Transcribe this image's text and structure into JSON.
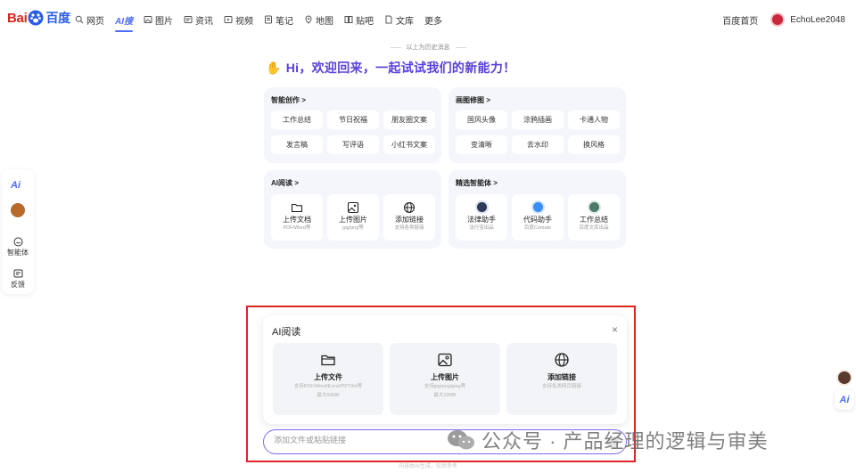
{
  "topbar": {
    "logo": {
      "bai": "Bai",
      "du": "du",
      "cn": "百度"
    },
    "nav": [
      {
        "label": "网页",
        "icon": "search-icon"
      },
      {
        "label": "AI搜",
        "icon": "",
        "active": true
      },
      {
        "label": "图片",
        "icon": "image-icon"
      },
      {
        "label": "资讯",
        "icon": "news-icon"
      },
      {
        "label": "视频",
        "icon": "video-icon"
      },
      {
        "label": "笔记",
        "icon": "note-icon"
      },
      {
        "label": "地图",
        "icon": "map-icon"
      },
      {
        "label": "贴吧",
        "icon": "tieba-icon"
      },
      {
        "label": "文库",
        "icon": "doc-icon"
      },
      {
        "label": "更多",
        "icon": ""
      }
    ],
    "home_link": "百度首页",
    "username": "EchoLee2048"
  },
  "history_divider": "以上为历史消息",
  "welcome": "Hi，欢迎回来，一起试试我们的新能力！",
  "cards": {
    "creation": {
      "title": "智能创作 >",
      "items": [
        "工作总结",
        "节日祝福",
        "朋友圈文案",
        "发言稿",
        "写评语",
        "小红书文案"
      ]
    },
    "image_edit": {
      "title": "画图修图 >",
      "items": [
        "国风头像",
        "涂鸦插画",
        "卡通人物",
        "变清晰",
        "去水印",
        "换风格"
      ]
    },
    "ai_read": {
      "title": "AI阅读 >",
      "items": [
        {
          "label": "上传文档",
          "sub": "PDF/Word等"
        },
        {
          "label": "上传图片",
          "sub": "jpg/png等"
        },
        {
          "label": "添加链接",
          "sub": "支持各类链接"
        }
      ]
    },
    "agents": {
      "title": "精选智能体 >",
      "items": [
        {
          "label": "法律助手",
          "sub": "法行宝出品"
        },
        {
          "label": "代码助手",
          "sub": "百度Comate"
        },
        {
          "label": "工作总结",
          "sub": "百度文库出品"
        }
      ]
    }
  },
  "leftbar": {
    "ai_label": "Ai",
    "items": [
      {
        "label": "智能体"
      },
      {
        "label": "反馈"
      }
    ]
  },
  "right_float": {
    "ai_label": "Ai"
  },
  "panel": {
    "title": "AI阅读",
    "close": "×",
    "tiles": [
      {
        "label": "上传文件",
        "sub1": "支持PDF/Word/Excel/PPT/txt等",
        "sub2": "最大50MB"
      },
      {
        "label": "上传图片",
        "sub1": "支持jpg/png/jpeg等",
        "sub2": "最大10MB"
      },
      {
        "label": "添加链接",
        "sub1": "支持各类网页链接",
        "sub2": ""
      }
    ],
    "input_placeholder": "添加文件或粘贴链接",
    "bottom_note": "内容由AI生成，仅供参考"
  },
  "watermark": "公众号 · 产品经理的逻辑与审美",
  "colors": {
    "accent": "#4e6ef2",
    "brand_red": "#d9251c",
    "welcome": "#5a3fd8",
    "highlight": "#e02424"
  }
}
